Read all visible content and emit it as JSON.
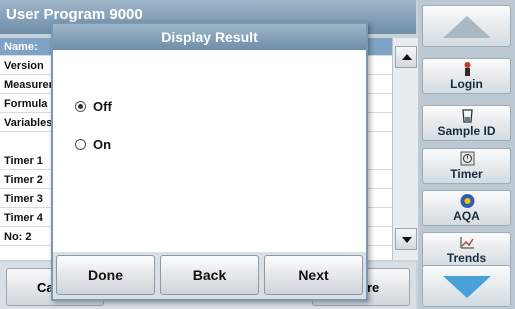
{
  "background": {
    "title": "User Program 9000",
    "rows": [
      {
        "label": "Name:",
        "selected": true
      },
      {
        "label": "Version",
        "selected": false
      },
      {
        "label": "Measurement",
        "selected": false
      },
      {
        "label": "Formula",
        "selected": false
      },
      {
        "label": "Variables",
        "selected": false
      },
      {
        "label": "Timer 1",
        "selected": false
      },
      {
        "label": "Timer 2",
        "selected": false
      },
      {
        "label": "Timer 3",
        "selected": false
      },
      {
        "label": "Timer 4",
        "selected": false
      },
      {
        "label": "No: 2",
        "selected": false
      }
    ],
    "bottom_left_label": "Ca",
    "bottom_right_label": "ore"
  },
  "sidebar": {
    "items": [
      {
        "label": "Login",
        "icon": "person-icon"
      },
      {
        "label": "Sample ID",
        "icon": "beaker-icon"
      },
      {
        "label": "Timer",
        "icon": "timer-icon"
      },
      {
        "label": "AQA",
        "icon": "aqa-icon"
      },
      {
        "label": "Trends",
        "icon": "trends-icon"
      }
    ]
  },
  "dialog": {
    "title": "Display Result",
    "options": [
      {
        "label": "Off",
        "selected": true
      },
      {
        "label": "On",
        "selected": false
      }
    ],
    "buttons": {
      "done": "Done",
      "back": "Back",
      "next": "Next"
    }
  },
  "colors": {
    "title_bar": "#7f9db6",
    "selection": "#7fa3c4",
    "sidebar": "#bcc9d3"
  }
}
